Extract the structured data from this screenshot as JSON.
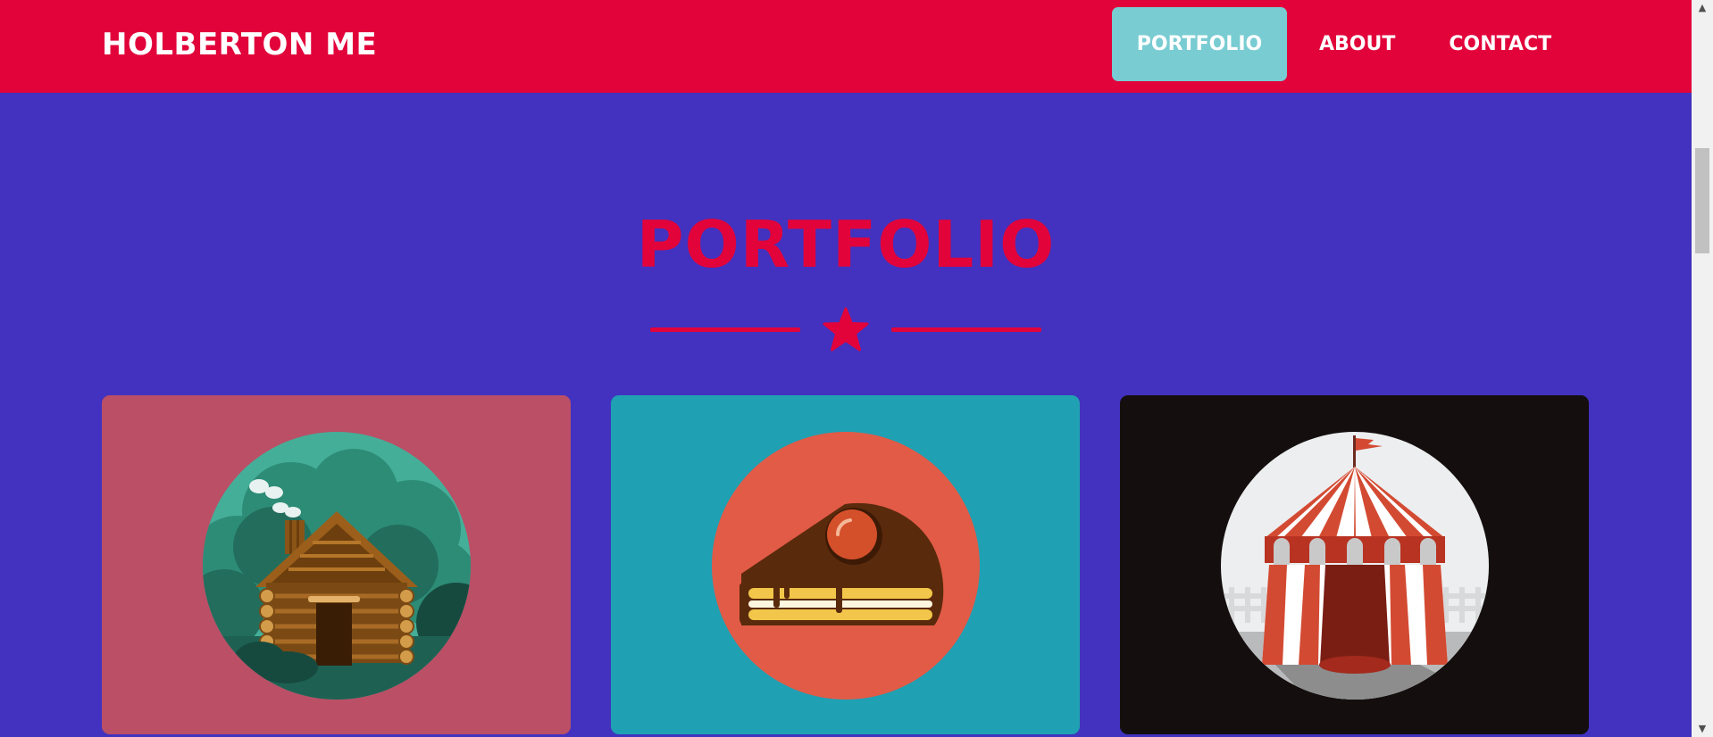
{
  "navbar": {
    "brand": "HOLBERTON ME",
    "items": [
      {
        "label": "PORTFOLIO",
        "active": true
      },
      {
        "label": "ABOUT",
        "active": false
      },
      {
        "label": "CONTACT",
        "active": false
      }
    ]
  },
  "section": {
    "title": "PORTFOLIO",
    "divider_icon": "star-icon"
  },
  "portfolio_items": [
    {
      "icon": "log-cabin-icon",
      "background": "#ba4f66"
    },
    {
      "icon": "cake-slice-icon",
      "background": "#1fa0b3"
    },
    {
      "icon": "circus-tent-icon",
      "background": "#140f0e"
    }
  ],
  "colors": {
    "navbar": "#e2033b",
    "page_background": "#4232bf",
    "active_nav": "#78ccd2",
    "accent": "#e2033b"
  }
}
